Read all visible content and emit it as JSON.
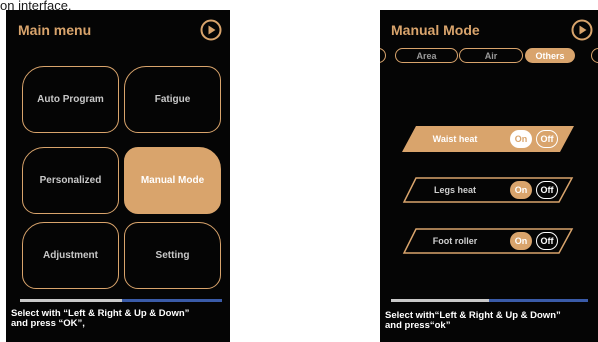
{
  "caption": "on interface.",
  "screen1": {
    "title": "Main menu",
    "icon": "play-icon",
    "items": [
      {
        "label": "Auto Program",
        "active": false
      },
      {
        "label": "Fatigue",
        "active": false
      },
      {
        "label": "Personalized",
        "active": false
      },
      {
        "label": "Manual Mode",
        "active": true
      },
      {
        "label": "Adjustment",
        "active": false
      },
      {
        "label": "Setting",
        "active": false
      }
    ],
    "hint": "Select with “Left & Right & Up & Down”\nand press “OK”,"
  },
  "screen2": {
    "title": "Manual Mode",
    "icon": "play-icon",
    "tabs": [
      {
        "label": "Area",
        "active": false
      },
      {
        "label": "Air",
        "active": false
      },
      {
        "label": "Others",
        "active": true
      }
    ],
    "toggles": [
      {
        "label": "Waist heat",
        "on": "On",
        "off": "Off",
        "selected": true
      },
      {
        "label": "Legs heat",
        "on": "On",
        "off": "Off",
        "selected": false
      },
      {
        "label": "Foot roller",
        "on": "On",
        "off": "Off",
        "selected": false
      }
    ],
    "hint": "Select with“Left & Right & Up & Down”\nand press“ok”"
  },
  "colors": {
    "accent": "#d9a46c",
    "background": "#050505",
    "progress_light": "#c9c9c9",
    "progress_blue": "#3a5ba8"
  }
}
